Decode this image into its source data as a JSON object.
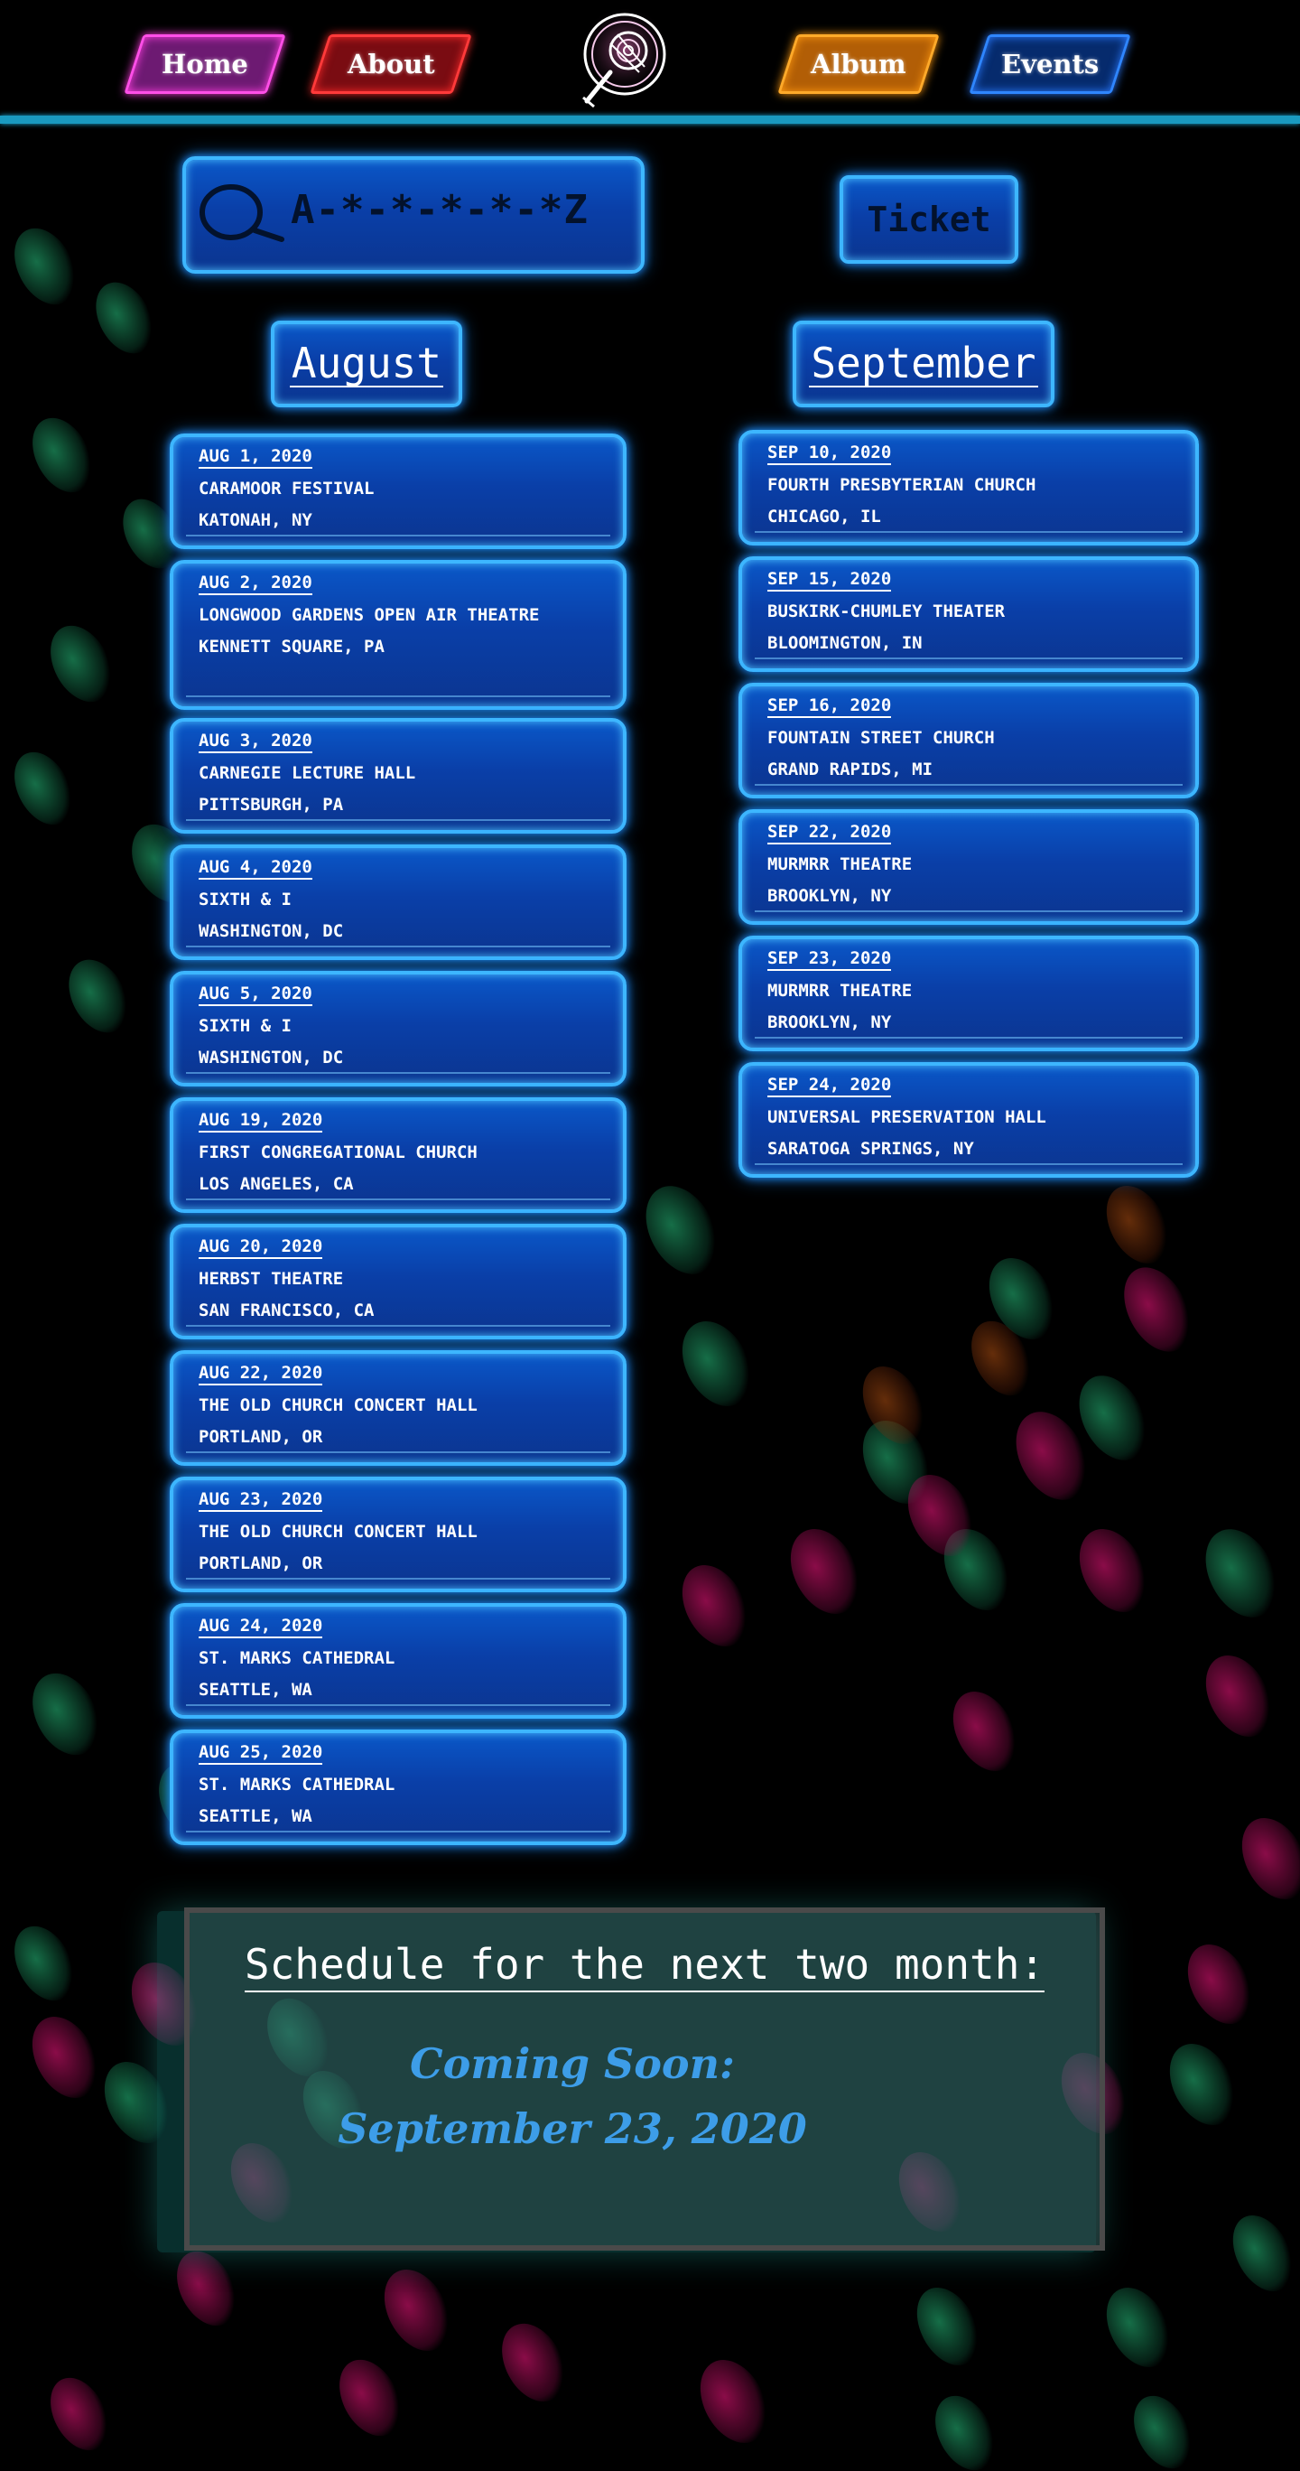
{
  "nav": {
    "home": "Home",
    "about": "About",
    "album": "Album",
    "events": "Events"
  },
  "search": {
    "text": "A-*-*-*-*-*Z"
  },
  "ticket": {
    "label": "Ticket"
  },
  "months": {
    "august": "August",
    "september": "September"
  },
  "august_events": [
    {
      "date": "AUG 1, 2020",
      "venue": "CARAMOOR FESTIVAL",
      "city": "KATONAH, NY"
    },
    {
      "date": "AUG 2, 2020",
      "venue": "LONGWOOD GARDENS OPEN AIR THEATRE",
      "city": "KENNETT SQUARE, PA"
    },
    {
      "date": "AUG 3, 2020",
      "venue": "CARNEGIE LECTURE HALL",
      "city": "PITTSBURGH, PA"
    },
    {
      "date": "AUG 4, 2020",
      "venue": "SIXTH & I",
      "city": "WASHINGTON, DC"
    },
    {
      "date": "AUG 5, 2020",
      "venue": "SIXTH & I",
      "city": "WASHINGTON, DC"
    },
    {
      "date": "AUG 19, 2020",
      "venue": "FIRST CONGREGATIONAL CHURCH",
      "city": "LOS ANGELES, CA"
    },
    {
      "date": "AUG 20, 2020",
      "venue": "HERBST THEATRE",
      "city": "SAN FRANCISCO, CA"
    },
    {
      "date": "AUG 22, 2020",
      "venue": "THE OLD CHURCH CONCERT HALL",
      "city": "PORTLAND, OR"
    },
    {
      "date": "AUG 23, 2020",
      "venue": "THE OLD CHURCH CONCERT HALL",
      "city": "PORTLAND, OR"
    },
    {
      "date": "AUG 24, 2020",
      "venue": "ST. MARKS CATHEDRAL",
      "city": "SEATTLE, WA"
    },
    {
      "date": "AUG 25, 2020",
      "venue": "ST. MARKS CATHEDRAL",
      "city": "SEATTLE, WA"
    }
  ],
  "september_events": [
    {
      "date": "SEP 10, 2020",
      "venue": "FOURTH PRESBYTERIAN CHURCH",
      "city": "CHICAGO, IL"
    },
    {
      "date": "SEP 15, 2020",
      "venue": "BUSKIRK-CHUMLEY THEATER",
      "city": "BLOOMINGTON, IN"
    },
    {
      "date": "SEP 16, 2020",
      "venue": "FOUNTAIN STREET CHURCH",
      "city": "GRAND RAPIDS, MI"
    },
    {
      "date": "SEP 22, 2020",
      "venue": "MURMRR THEATRE",
      "city": "BROOKLYN, NY"
    },
    {
      "date": "SEP 23, 2020",
      "venue": "MURMRR THEATRE",
      "city": "BROOKLYN, NY"
    },
    {
      "date": "SEP 24, 2020",
      "venue": "UNIVERSAL PRESERVATION HALL",
      "city": "SARATOGA SPRINGS, NY"
    }
  ],
  "schedule": {
    "title": "Schedule for the next two month:",
    "coming_soon": "Coming Soon:",
    "date": "September 23, 2020"
  },
  "icons": {
    "logo": "neon-guitar-logo-icon",
    "search": "magnifier-icon"
  }
}
